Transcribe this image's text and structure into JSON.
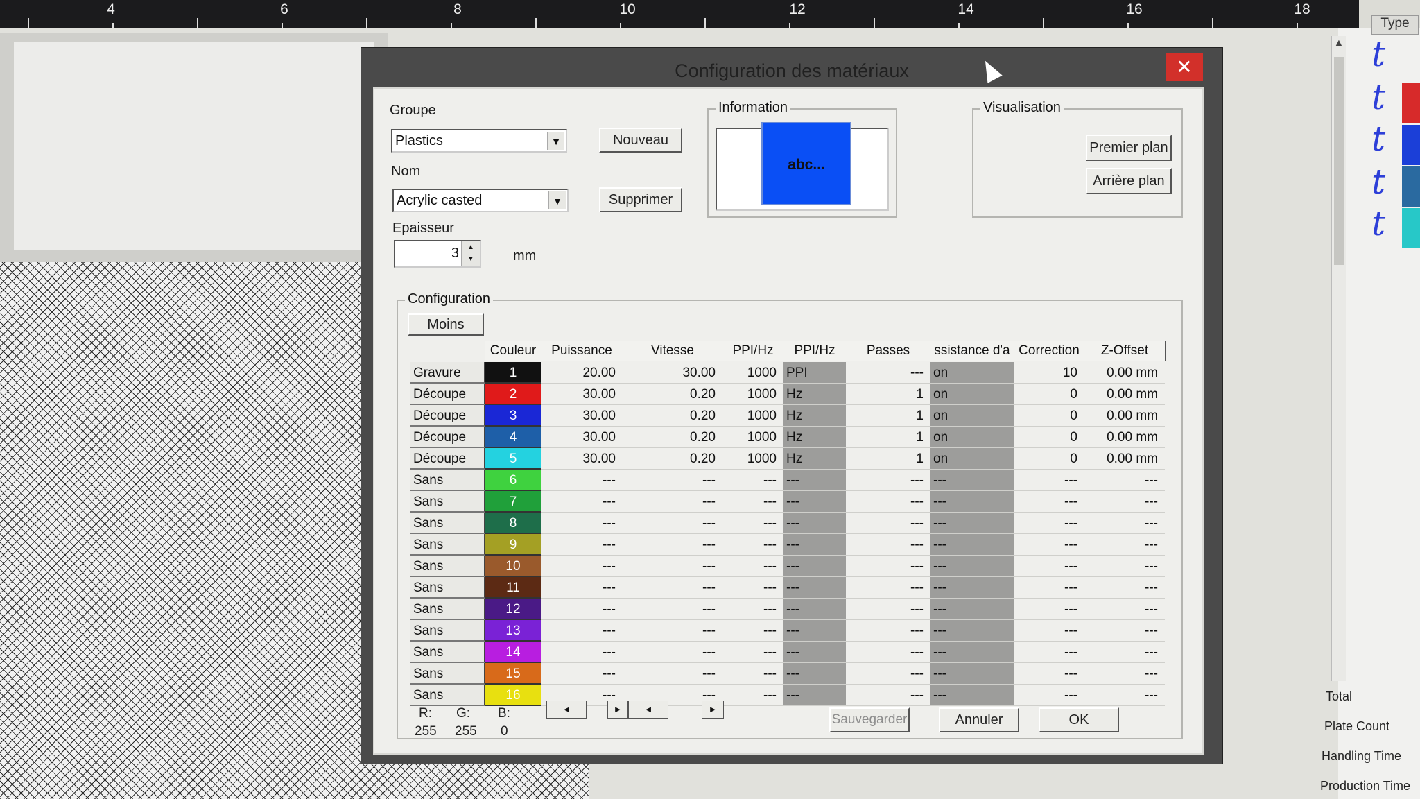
{
  "ruler": {
    "labels": [
      "4",
      "6",
      "8",
      "10",
      "12",
      "14",
      "16",
      "18"
    ]
  },
  "side_panel": {
    "type_header": "Type",
    "type_icon_glyph": "t",
    "type_swatches": [
      "#d72a2a",
      "#1b3fd8",
      "#2a6aa0",
      "#27c8c8"
    ],
    "stats": [
      "Total",
      "Plate Count",
      "Handling Time",
      "Production Time"
    ]
  },
  "dialog": {
    "title": "Configuration des matériaux",
    "close_glyph": "✕",
    "groupe": {
      "label": "Groupe",
      "value": "Plastics"
    },
    "nom": {
      "label": "Nom",
      "value": "Acrylic casted"
    },
    "epaisseur": {
      "label": "Epaisseur",
      "value": "3",
      "unit": "mm"
    },
    "buttons": {
      "nouveau": "Nouveau",
      "supprimer": "Supprimer",
      "premier_plan": "Premier plan",
      "arriere_plan": "Arrière plan",
      "moins": "Moins",
      "sauvegarder": "Sauvegarder",
      "annuler": "Annuler",
      "ok": "OK"
    },
    "information": {
      "label": "Information",
      "text": ""
    },
    "visualisation": {
      "label": "Visualisation",
      "preview_text": "abc...",
      "preview_color": "#0a4ff5"
    },
    "configuration": {
      "label": "Configuration",
      "columns": [
        "",
        "Couleur",
        "Puissance",
        "Vitesse",
        "PPI/Hz",
        "PPI/Hz",
        "Passes",
        "ssistance d'a",
        "Correction",
        "Z-Offset"
      ],
      "rows": [
        {
          "type": "Gravure",
          "num": "1",
          "color": "#111111",
          "puissance": "20.00",
          "vitesse": "30.00",
          "ppi": "1000",
          "mode": "PPI",
          "passes": "---",
          "assist": "on",
          "correction": "10",
          "zoffset": "0.00 mm"
        },
        {
          "type": "Découpe",
          "num": "2",
          "color": "#e01a1a",
          "puissance": "30.00",
          "vitesse": "0.20",
          "ppi": "1000",
          "mode": "Hz",
          "passes": "1",
          "assist": "on",
          "correction": "0",
          "zoffset": "0.00 mm"
        },
        {
          "type": "Découpe",
          "num": "3",
          "color": "#1a27d6",
          "puissance": "30.00",
          "vitesse": "0.20",
          "ppi": "1000",
          "mode": "Hz",
          "passes": "1",
          "assist": "on",
          "correction": "0",
          "zoffset": "0.00 mm"
        },
        {
          "type": "Découpe",
          "num": "4",
          "color": "#1e5fa8",
          "puissance": "30.00",
          "vitesse": "0.20",
          "ppi": "1000",
          "mode": "Hz",
          "passes": "1",
          "assist": "on",
          "correction": "0",
          "zoffset": "0.00 mm"
        },
        {
          "type": "Découpe",
          "num": "5",
          "color": "#24d2e0",
          "puissance": "30.00",
          "vitesse": "0.20",
          "ppi": "1000",
          "mode": "Hz",
          "passes": "1",
          "assist": "on",
          "correction": "0",
          "zoffset": "0.00 mm"
        },
        {
          "type": "Sans",
          "num": "6",
          "color": "#3fd23f",
          "puissance": "---",
          "vitesse": "---",
          "ppi": "---",
          "mode": "---",
          "passes": "---",
          "assist": "---",
          "correction": "---",
          "zoffset": "---"
        },
        {
          "type": "Sans",
          "num": "7",
          "color": "#20a03a",
          "puissance": "---",
          "vitesse": "---",
          "ppi": "---",
          "mode": "---",
          "passes": "---",
          "assist": "---",
          "correction": "---",
          "zoffset": "---"
        },
        {
          "type": "Sans",
          "num": "8",
          "color": "#1e6e4a",
          "puissance": "---",
          "vitesse": "---",
          "ppi": "---",
          "mode": "---",
          "passes": "---",
          "assist": "---",
          "correction": "---",
          "zoffset": "---"
        },
        {
          "type": "Sans",
          "num": "9",
          "color": "#a4a024",
          "puissance": "---",
          "vitesse": "---",
          "ppi": "---",
          "mode": "---",
          "passes": "---",
          "assist": "---",
          "correction": "---",
          "zoffset": "---"
        },
        {
          "type": "Sans",
          "num": "10",
          "color": "#9a5a2c",
          "puissance": "---",
          "vitesse": "---",
          "ppi": "---",
          "mode": "---",
          "passes": "---",
          "assist": "---",
          "correction": "---",
          "zoffset": "---"
        },
        {
          "type": "Sans",
          "num": "11",
          "color": "#5c2a14",
          "puissance": "---",
          "vitesse": "---",
          "ppi": "---",
          "mode": "---",
          "passes": "---",
          "assist": "---",
          "correction": "---",
          "zoffset": "---"
        },
        {
          "type": "Sans",
          "num": "12",
          "color": "#4a1a86",
          "puissance": "---",
          "vitesse": "---",
          "ppi": "---",
          "mode": "---",
          "passes": "---",
          "assist": "---",
          "correction": "---",
          "zoffset": "---"
        },
        {
          "type": "Sans",
          "num": "13",
          "color": "#7a22d6",
          "puissance": "---",
          "vitesse": "---",
          "ppi": "---",
          "mode": "---",
          "passes": "---",
          "assist": "---",
          "correction": "---",
          "zoffset": "---"
        },
        {
          "type": "Sans",
          "num": "14",
          "color": "#b81ee0",
          "puissance": "---",
          "vitesse": "---",
          "ppi": "---",
          "mode": "---",
          "passes": "---",
          "assist": "---",
          "correction": "---",
          "zoffset": "---"
        },
        {
          "type": "Sans",
          "num": "15",
          "color": "#d86a1a",
          "puissance": "---",
          "vitesse": "---",
          "ppi": "---",
          "mode": "---",
          "passes": "---",
          "assist": "---",
          "correction": "---",
          "zoffset": "---"
        },
        {
          "type": "Sans",
          "num": "16",
          "color": "#e8e010",
          "puissance": "---",
          "vitesse": "---",
          "ppi": "---",
          "mode": "---",
          "passes": "---",
          "assist": "---",
          "correction": "---",
          "zoffset": "---"
        }
      ]
    },
    "rgb": {
      "r_label": "R:",
      "g_label": "G:",
      "b_label": "B:",
      "r": "255",
      "g": "255",
      "b": "0"
    }
  }
}
